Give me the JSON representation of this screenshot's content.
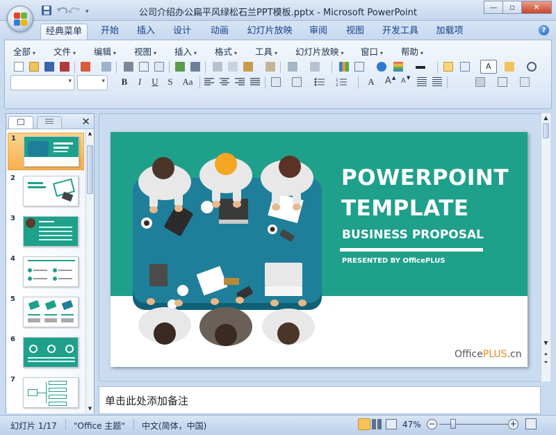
{
  "window": {
    "title": "公司介绍办公扁平风绿松石兰PPT模板.pptx - Microsoft PowerPoint",
    "controls": {
      "minimize": "—",
      "restore": "▫",
      "close": "✕"
    }
  },
  "ribbon_tabs": [
    "经典菜单",
    "开始",
    "插入",
    "设计",
    "动画",
    "幻灯片放映",
    "审阅",
    "视图",
    "开发工具",
    "加载项"
  ],
  "help": "?",
  "menus": [
    "全部",
    "文件",
    "编辑",
    "视图",
    "插入",
    "格式",
    "工具",
    "幻灯片放映",
    "窗口",
    "帮助"
  ],
  "format_buttons": {
    "bold": "B",
    "italic": "I",
    "underline": "U",
    "shadow": "S",
    "case": "Aa",
    "font_color": "A"
  },
  "thumbnails": [
    {
      "num": "1",
      "selected": true
    },
    {
      "num": "2",
      "selected": false
    },
    {
      "num": "3",
      "selected": false
    },
    {
      "num": "4",
      "selected": false
    },
    {
      "num": "5",
      "selected": false
    },
    {
      "num": "6",
      "selected": false
    },
    {
      "num": "7",
      "selected": false
    }
  ],
  "slide": {
    "title_line1": "POWERPOINT",
    "title_line2": "TEMPLATE",
    "subtitle": "BUSINESS PROPOSAL",
    "presenter": "PRESENTED BY OfficePLUS",
    "logo_part1": "Office",
    "logo_part2": "PLUS",
    "logo_part3": ".cn",
    "colors": {
      "teal": "#1fa08b",
      "table": "#1f7e9a",
      "white": "#ffffff"
    }
  },
  "notes_placeholder": "单击此处添加备注",
  "status": {
    "slide_info": "幻灯片 1/17",
    "theme": "\"Office 主题\"",
    "language": "中文(简体，中国)",
    "zoom": "47%"
  }
}
